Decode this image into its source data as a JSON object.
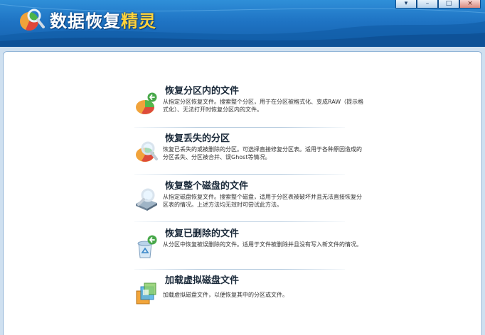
{
  "header": {
    "title_main": "数据恢复",
    "title_accent": "精灵",
    "brand_color": "#1f74c4",
    "accent_color": "#ffd23a",
    "controls": {
      "dropdown": "▾",
      "minimize": "–",
      "maximize": "□",
      "close": "×"
    }
  },
  "items": [
    {
      "icon": "partition-restore-icon",
      "title": "恢复分区内的文件",
      "desc": "从指定分区恢复文件。搜索整个分区，用于在分区被格式化、变成RAW（提示格式化）、无法打开时恢复分区内的文件。"
    },
    {
      "icon": "lost-partition-search-icon",
      "title": "恢复丢失的分区",
      "desc": "恢复已丢失的或被删除的分区。可选择直接修复分区表。适用于各种原因造成的分区丢失、分区被合并、误Ghost等情况。"
    },
    {
      "icon": "disk-scan-icon",
      "title": "恢复整个磁盘的文件",
      "desc": "从指定磁盘恢复文件。搜索整个磁盘，适用于分区表被破坏并且无法直接恢复分区表的情况。上述方法均无效时可尝试此方法。"
    },
    {
      "icon": "recycle-bin-restore-icon",
      "title": "恢复已删除的文件",
      "desc": "从分区中恢复被误删除的文件。适用于文件被删除并且没有写入新文件的情况。"
    },
    {
      "icon": "virtual-disk-icon",
      "title": "加载虚拟磁盘文件",
      "desc": "加载虚拟磁盘文件，以便恢复其中的分区或文件。"
    }
  ]
}
